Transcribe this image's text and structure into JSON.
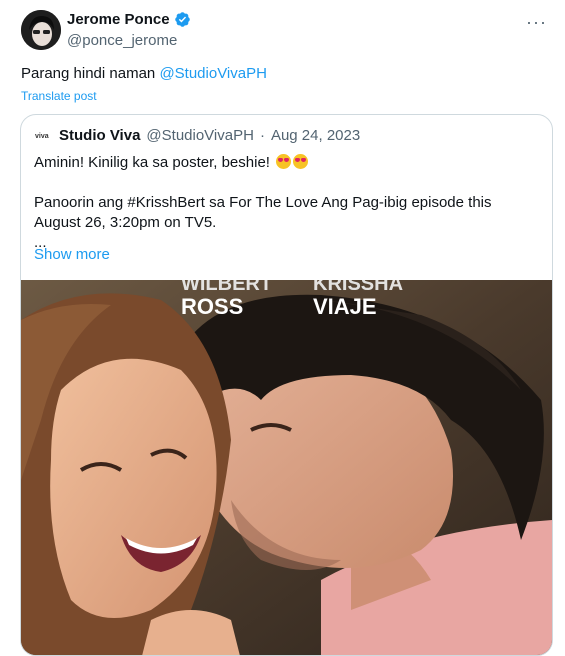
{
  "tweet": {
    "author_name": "Jerome Ponce",
    "author_handle": "@ponce_jerome",
    "text_prefix": "Parang hindi naman ",
    "mention": "@StudioVivaPH",
    "translate_label": "Translate post",
    "more_label": "···"
  },
  "quote": {
    "author_name": "Studio Viva",
    "author_handle": "@StudioVivaPH",
    "separator": "·",
    "date": "Aug 24, 2023",
    "line1": "Aminin! Kinilig ka sa poster, beshie!",
    "line2": "Panoorin ang #KrisshBert sa For The Love Ang Pag-ibig episode this August 26, 3:20pm on TV5.",
    "ellipsis": "...",
    "show_more_label": "Show more",
    "poster": {
      "name_left": "ROSS",
      "name_right": "VIAJE",
      "name_left_partial": "WILBERT",
      "name_right_partial": "KRISSHA"
    }
  },
  "colors": {
    "link": "#1d9bf0",
    "verified": "#1d9bf0",
    "muted": "#536471"
  }
}
